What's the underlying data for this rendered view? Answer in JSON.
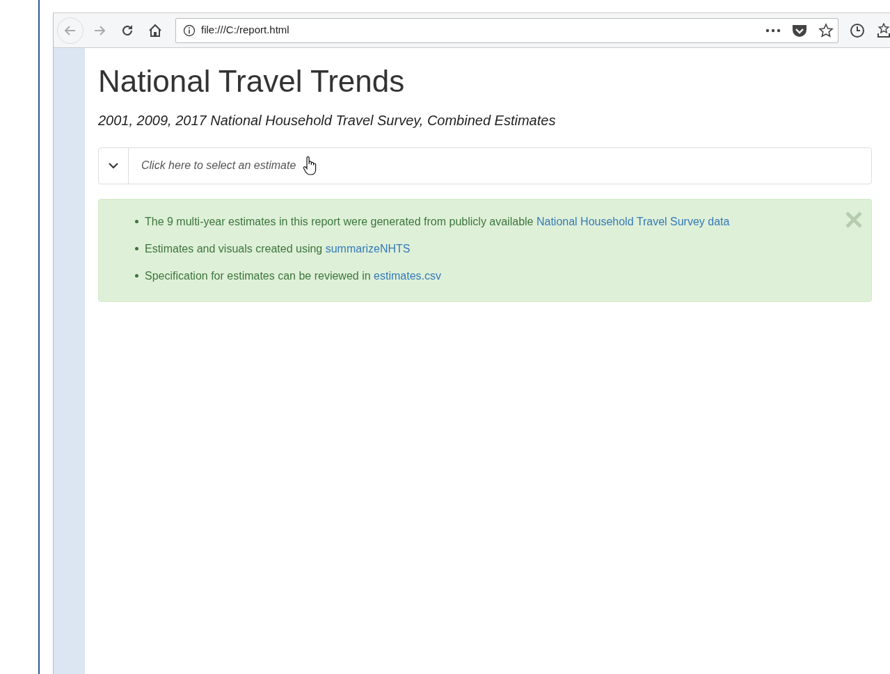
{
  "browser": {
    "url": "file:///C:/report.html"
  },
  "page": {
    "title": "National Travel Trends",
    "subtitle": "2001, 2009, 2017 National Household Travel Survey, Combined Estimates",
    "selector": {
      "placeholder": "Click here to select an estimate",
      "expanded": false
    },
    "notice": {
      "items": [
        {
          "text": "The 9 multi-year estimates in this report were generated from publicly available ",
          "link": "National Household Travel Survey data"
        },
        {
          "text": "Estimates and visuals created using ",
          "link": "summarizeNHTS"
        },
        {
          "text": "Specification for estimates can be reviewed in ",
          "link": "estimates.csv"
        }
      ]
    }
  }
}
